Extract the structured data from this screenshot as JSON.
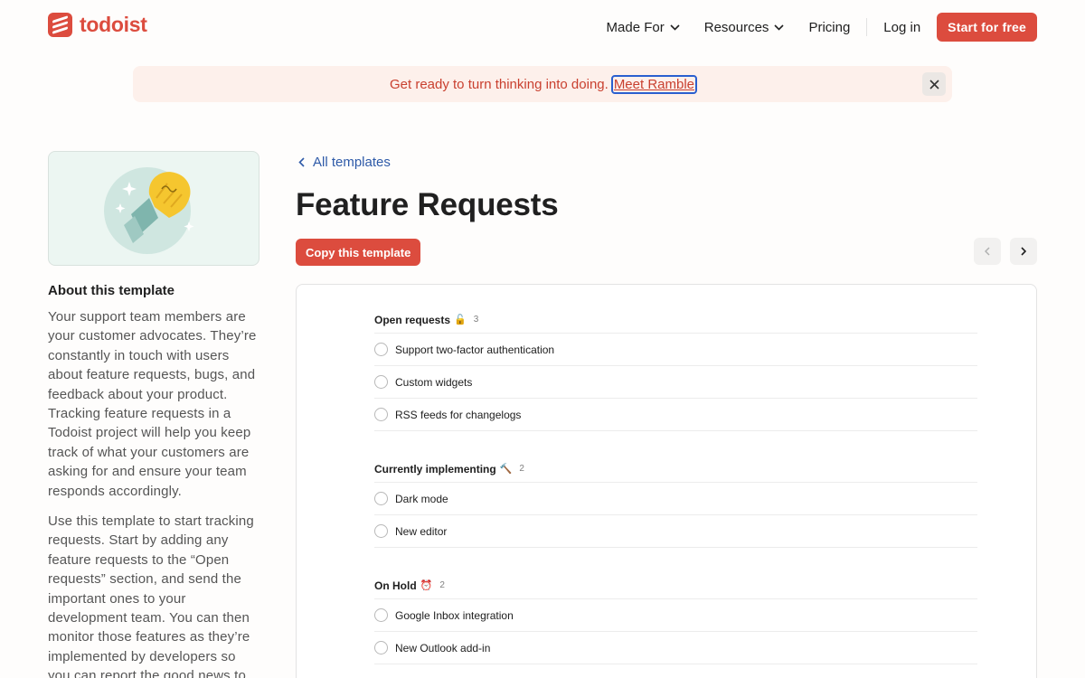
{
  "header": {
    "logo_text": "todoist",
    "nav": {
      "made_for": "Made For",
      "resources": "Resources",
      "pricing": "Pricing",
      "login": "Log in",
      "cta": "Start for free"
    }
  },
  "banner": {
    "text": "Get ready to turn thinking into doing.",
    "link": "Meet Ramble"
  },
  "sidebar": {
    "about_title": "About this template",
    "paragraph_1": "Your support team members are your customer advocates. They’re constantly in touch with users about feature requests, bugs, and feedback about your product. Tracking feature requests in a Todoist project will help you keep track of what your customers are asking for and ensure your team responds accordingly.",
    "paragraph_2": "Use this template to start tracking requests. Start by adding any feature requests to the “Open requests” section, and send the important ones to your development team. You can then monitor those features as they’re implemented by developers so you can report the good news to your"
  },
  "main": {
    "back_link": "All templates",
    "title": "Feature Requests",
    "copy_button": "Copy this template"
  },
  "preview": {
    "sections": [
      {
        "name": "Open requests",
        "emoji": "🔓",
        "count": "3",
        "tasks": [
          "Support two-factor authentication",
          "Custom widgets",
          "RSS feeds for changelogs"
        ]
      },
      {
        "name": "Currently implementing",
        "emoji": "🔨",
        "count": "2",
        "tasks": [
          "Dark mode",
          "New editor"
        ]
      },
      {
        "name": "On Hold",
        "emoji": "⏰",
        "count": "2",
        "tasks": [
          "Google Inbox integration",
          "New Outlook add-in"
        ]
      }
    ]
  },
  "colors": {
    "brand": "#dc4c3e",
    "banner_bg": "#fdf0eb",
    "link": "#2e5aa8"
  }
}
